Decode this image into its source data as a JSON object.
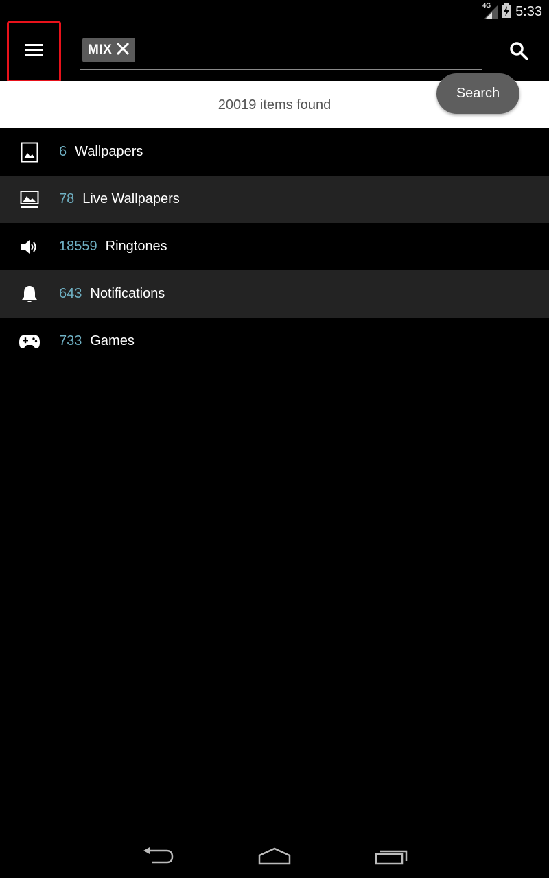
{
  "status_bar": {
    "network_label": "4G",
    "time": "5:33",
    "icons": [
      "signal-icon",
      "battery-icon"
    ]
  },
  "top_bar": {
    "menu_icon": "hamburger-menu-icon",
    "chip_label": "MIX",
    "chip_close_icon": "close-icon",
    "search_icon": "search-icon"
  },
  "results": {
    "text": "20019 items found",
    "search_button_label": "Search"
  },
  "categories": [
    {
      "count": "6",
      "label": "Wallpapers",
      "icon": "image-icon"
    },
    {
      "count": "78",
      "label": "Live Wallpapers",
      "icon": "live-wallpaper-icon"
    },
    {
      "count": "18559",
      "label": "Ringtones",
      "icon": "speaker-icon"
    },
    {
      "count": "643",
      "label": "Notifications",
      "icon": "bell-icon"
    },
    {
      "count": "733",
      "label": "Games",
      "icon": "gamepad-icon"
    }
  ],
  "nav_bar": {
    "icons": [
      "back-icon",
      "home-icon",
      "recent-apps-icon"
    ]
  },
  "colors": {
    "count_accent": "#6fb0c3",
    "highlight_border": "#e8121b",
    "alt_row": "#232323"
  }
}
